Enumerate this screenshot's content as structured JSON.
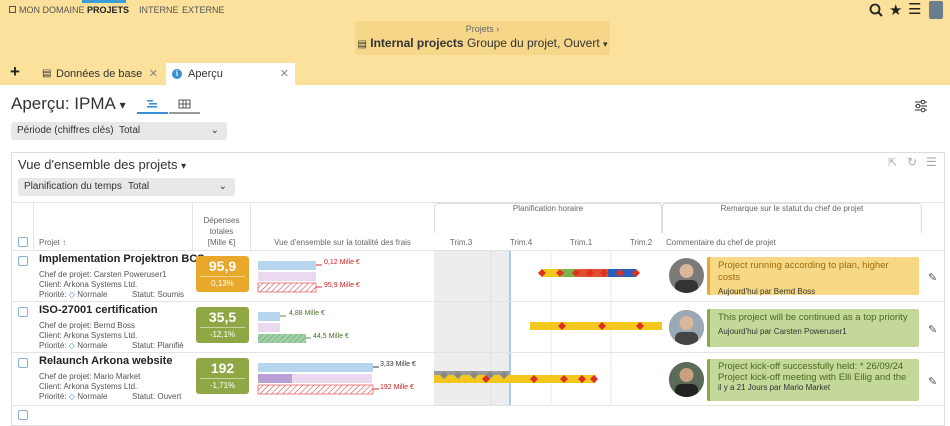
{
  "nav": {
    "domain": "MON DOMAINE",
    "items": [
      "PROJETS",
      "INTERNE",
      "EXTERNE"
    ]
  },
  "breadcrumb": {
    "parent": "Projets",
    "title": "Internal projects",
    "subtitle": "Groupe du projet, Ouvert"
  },
  "tabs": [
    {
      "label": "Données de base"
    },
    {
      "label": "Aperçu"
    }
  ],
  "page": {
    "title": "Aperçu: IPMA"
  },
  "filter_period": {
    "label": "Période (chiffres clés)",
    "value": "Total"
  },
  "panel": {
    "title": "Vue d'ensemble des projets",
    "filter_label": "Planification du temps",
    "filter_value": "Total"
  },
  "columns": {
    "project": "Projet ↑",
    "expenses": [
      "Dépenses",
      "totales",
      "[Mille €]"
    ],
    "overview": "Vue d'ensemble sur la totalité des frais",
    "timeplan": "Planification horaire",
    "quarters": [
      "Trim.3",
      "Trim.4",
      "Trim.1",
      "Trim.2"
    ],
    "remark_group": "Remarque sur le statut du chef de projet",
    "comment": "Commentaire du chef de projet"
  },
  "rows": [
    {
      "name": "Implementation Projektron BCS",
      "manager": "Chef de projet: Carsten Poweruser1",
      "client": "Client: Arkona Systems Ltd.",
      "priority_label": "Priorité:",
      "priority": "Normale",
      "status": "Statut: Soumis",
      "kpi": "95,9",
      "kpi_pct": "0,13%",
      "kpi_color": "#e8a82a",
      "bar1": "0,12 Mille €",
      "bar2": "95,9 Mille €",
      "comment": "Project running according to plan, higher costs",
      "comment_by": "Aujourd'hui par Bernd Boss",
      "comment_color": "#f7d884",
      "comment_border": "#e8a82a"
    },
    {
      "name": "ISO-27001 certification",
      "manager": "Chef de projet: Bernd Boss",
      "client": "Client: Arkona Systems Ltd.",
      "priority_label": "Priorité:",
      "priority": "Normale",
      "status": "Statut: Planifié",
      "kpi": "35,5",
      "kpi_pct": "-12,1%",
      "kpi_color": "#8fa845",
      "bar1": "4,88 Mille €",
      "bar2": "44,5 Mille €",
      "comment": "This project will be continued as a top priority",
      "comment_by": "Aujourd'hui par Carsten Poweruser1",
      "comment_color": "#c4d89a",
      "comment_border": "#8fa845"
    },
    {
      "name": "Relaunch Arkona website",
      "manager": "Chef de projet: Mario Market",
      "client": "Client: Arkona Systems Ltd.",
      "priority_label": "Priorité:",
      "priority": "Normale",
      "status": "Statut: Ouvert",
      "kpi": "192",
      "kpi_pct": "-1,71%",
      "kpi_color": "#8fa845",
      "bar1": "3,33 Mille €",
      "bar2": "192 Mille €",
      "comment": "Project kick-off successfully held: * 26/09/24 Project kick-off meeting with Elli Eilig and the",
      "comment_by": "il y a 21 Jours par Mario Market",
      "comment_color": "#c4d89a",
      "comment_border": "#8fa845"
    }
  ]
}
